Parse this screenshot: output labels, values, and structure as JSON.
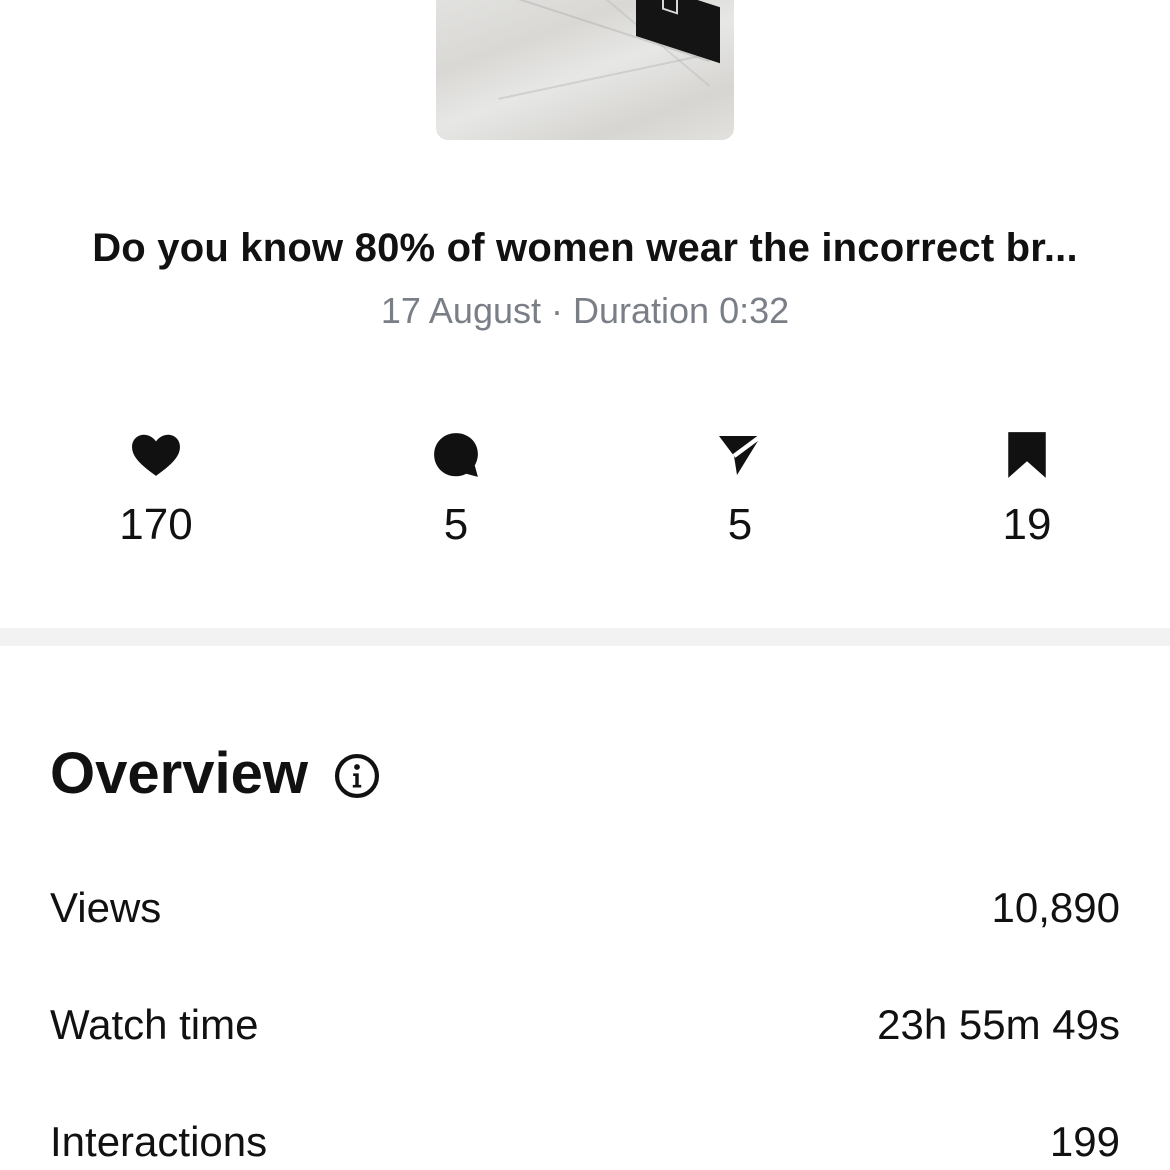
{
  "post": {
    "title": "Do you know 80% of women wear the incorrect br...",
    "date": "17 August",
    "separator": " · ",
    "duration": "Duration 0:32"
  },
  "engagement": [
    {
      "icon": "heart-icon",
      "value": "170"
    },
    {
      "icon": "comment-icon",
      "value": "5"
    },
    {
      "icon": "share-icon",
      "value": "5"
    },
    {
      "icon": "bookmark-icon",
      "value": "19"
    }
  ],
  "overview": {
    "title": "Overview",
    "info_icon": "info-icon",
    "rows": [
      {
        "label": "Views",
        "value": "10,890"
      },
      {
        "label": "Watch time",
        "value": "23h 55m 49s"
      },
      {
        "label": "Interactions",
        "value": "199"
      }
    ]
  },
  "colors": {
    "text": "#111111",
    "muted": "#7a7f87",
    "divider": "#f2f2f2"
  }
}
